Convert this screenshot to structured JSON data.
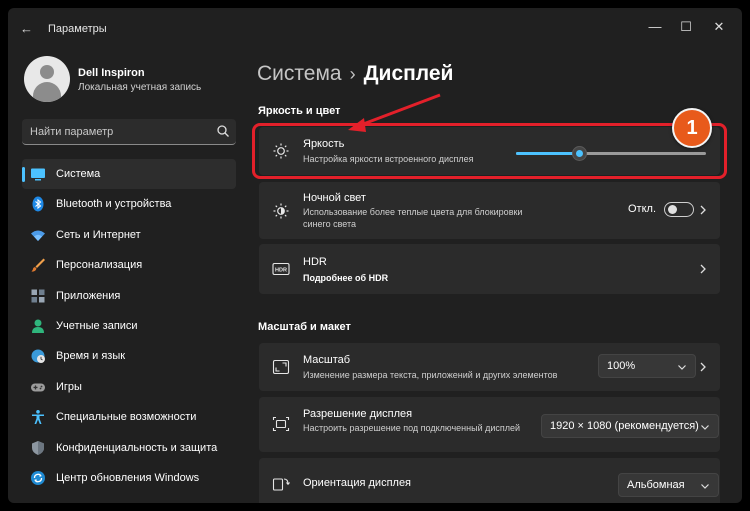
{
  "window": {
    "title": "Параметры",
    "back_glyph": "←",
    "minimize_glyph": "—",
    "maximize_glyph": "☐",
    "close_glyph": "✕"
  },
  "profile": {
    "name": "Dell Inspiron",
    "account_type": "Локальная учетная запись"
  },
  "search": {
    "placeholder": "Найти параметр"
  },
  "sidebar": {
    "items": [
      {
        "label": "Система",
        "icon": "monitor-icon",
        "active": true
      },
      {
        "label": "Bluetooth и устройства",
        "icon": "bluetooth-icon"
      },
      {
        "label": "Сеть и Интернет",
        "icon": "wifi-icon"
      },
      {
        "label": "Персонализация",
        "icon": "brush-icon"
      },
      {
        "label": "Приложения",
        "icon": "apps-icon"
      },
      {
        "label": "Учетные записи",
        "icon": "person-icon"
      },
      {
        "label": "Время и язык",
        "icon": "globe-clock-icon"
      },
      {
        "label": "Игры",
        "icon": "gamepad-icon"
      },
      {
        "label": "Специальные возможности",
        "icon": "accessibility-icon"
      },
      {
        "label": "Конфиденциальность и защита",
        "icon": "shield-icon"
      },
      {
        "label": "Центр обновления Windows",
        "icon": "update-icon"
      }
    ]
  },
  "main": {
    "breadcrumb": {
      "parent": "Система",
      "separator": "›",
      "current": "Дисплей"
    },
    "section_brightness": "Яркость и цвет",
    "brightness": {
      "title": "Яркость",
      "subtitle": "Настройка яркости встроенного дисплея",
      "level": 0.33
    },
    "night_light": {
      "title": "Ночной свет",
      "subtitle": "Использование более теплые цвета для блокировки синего света",
      "state": "Откл."
    },
    "hdr": {
      "title": "HDR",
      "link": "Подробнее об HDR"
    },
    "section_scale": "Масштаб и макет",
    "scale": {
      "title": "Масштаб",
      "subtitle": "Изменение размера текста, приложений и других элементов",
      "value": "100%"
    },
    "resolution": {
      "title": "Разрешение дисплея",
      "subtitle": "Настроить разрешение под подключенный дисплей",
      "value": "1920 × 1080 (рекомендуется)"
    },
    "orientation": {
      "title": "Ориентация дисплея",
      "value": "Альбомная"
    }
  },
  "annotation": {
    "badge": "1",
    "color": "#e3202a"
  },
  "colors": {
    "accent": "#4cc2ff",
    "background": "#202020",
    "card": "#2b2b2b",
    "badge": "#e85a1b"
  }
}
